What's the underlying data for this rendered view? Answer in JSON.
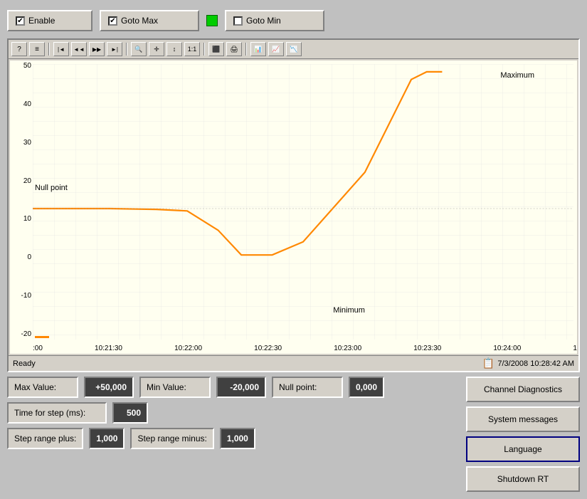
{
  "topButtons": {
    "enable": {
      "label": "Enable",
      "checked": true
    },
    "gotoMax": {
      "label": "Goto Max",
      "checked": true,
      "indicator": "green"
    },
    "gotoMin": {
      "label": "Goto Min",
      "checked": false
    }
  },
  "toolbar": {
    "buttons": [
      "?",
      "≡",
      "|◄",
      "◄◄",
      "▶▶",
      "►|",
      "🔍",
      "✛",
      "↕",
      "1:1",
      "⛔",
      "🖨",
      "📊",
      "📈",
      "📉"
    ]
  },
  "chart": {
    "yAxisLabels": [
      "50",
      "40",
      "30",
      "20",
      "10",
      "0",
      "-10",
      "-20"
    ],
    "xAxisLabels": [
      ":00",
      "10:21:30",
      "10:22:00",
      "10:22:30",
      "10:23:00",
      "10:23:30",
      "10:24:00",
      "1"
    ],
    "annotations": {
      "maximum": "Maximum",
      "minimum": "Minimum",
      "nullPoint": "Null point"
    },
    "statusBar": {
      "left": "Ready",
      "right": "7/3/2008  10:28:42 AM"
    }
  },
  "fields": {
    "maxValue": {
      "label": "Max Value:",
      "value": "+50,000"
    },
    "minValue": {
      "label": "Min Value:",
      "value": "-20,000"
    },
    "nullPoint": {
      "label": "Null point:",
      "value": "0,000"
    },
    "timeForStep": {
      "label": "Time for step (ms):",
      "value": "500"
    },
    "stepRangePlus": {
      "label": "Step range plus:",
      "value": "1,000"
    },
    "stepRangeMinus": {
      "label": "Step range minus:",
      "value": "1,000"
    }
  },
  "buttons": {
    "channelDiagnostics": "Channel Diagnostics",
    "systemMessages": "System messages",
    "language": "Language",
    "shutdownRT": "Shutdown RT"
  }
}
